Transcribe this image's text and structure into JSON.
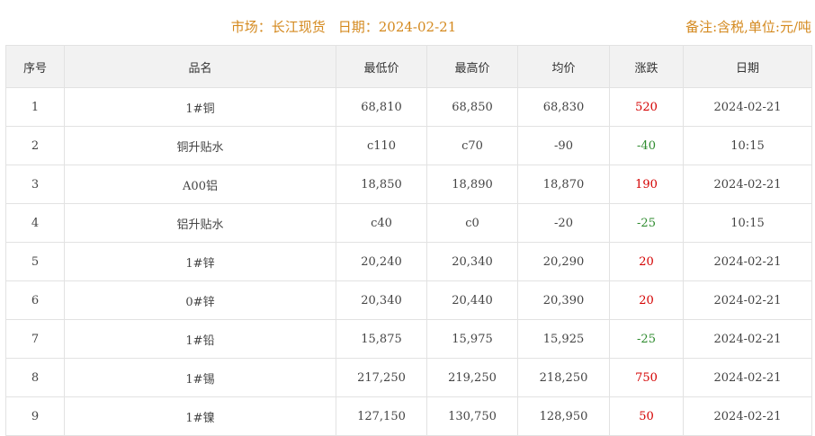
{
  "header": {
    "market_label": "市场：长江现货",
    "date_label": "日期：2024-02-21",
    "note": "备注:含税,单位:元/吨"
  },
  "columns": [
    "序号",
    "品名",
    "最低价",
    "最高价",
    "均价",
    "涨跌",
    "日期"
  ],
  "rows": [
    {
      "index": "1",
      "name": "1#铜",
      "low": "68,810",
      "high": "68,850",
      "avg": "68,830",
      "change": "520",
      "trend": "up",
      "date": "2024-02-21"
    },
    {
      "index": "2",
      "name": "铜升贴水",
      "low": "c110",
      "high": "c70",
      "avg": "-90",
      "change": "-40",
      "trend": "down",
      "date": "10:15"
    },
    {
      "index": "3",
      "name": "A00铝",
      "low": "18,850",
      "high": "18,890",
      "avg": "18,870",
      "change": "190",
      "trend": "up",
      "date": "2024-02-21"
    },
    {
      "index": "4",
      "name": "铝升贴水",
      "low": "c40",
      "high": "c0",
      "avg": "-20",
      "change": "-25",
      "trend": "down",
      "date": "10:15"
    },
    {
      "index": "5",
      "name": "1#锌",
      "low": "20,240",
      "high": "20,340",
      "avg": "20,290",
      "change": "20",
      "trend": "up",
      "date": "2024-02-21"
    },
    {
      "index": "6",
      "name": "0#锌",
      "low": "20,340",
      "high": "20,440",
      "avg": "20,390",
      "change": "20",
      "trend": "up",
      "date": "2024-02-21"
    },
    {
      "index": "7",
      "name": "1#铅",
      "low": "15,875",
      "high": "15,975",
      "avg": "15,925",
      "change": "-25",
      "trend": "down",
      "date": "2024-02-21"
    },
    {
      "index": "8",
      "name": "1#锡",
      "low": "217,250",
      "high": "219,250",
      "avg": "218,250",
      "change": "750",
      "trend": "up",
      "date": "2024-02-21"
    },
    {
      "index": "9",
      "name": "1#镍",
      "low": "127,150",
      "high": "130,750",
      "avg": "128,950",
      "change": "50",
      "trend": "up",
      "date": "2024-02-21"
    }
  ],
  "colors": {
    "header_text": "#d4891e",
    "up": "#d40000",
    "down": "#2e8b2e"
  }
}
